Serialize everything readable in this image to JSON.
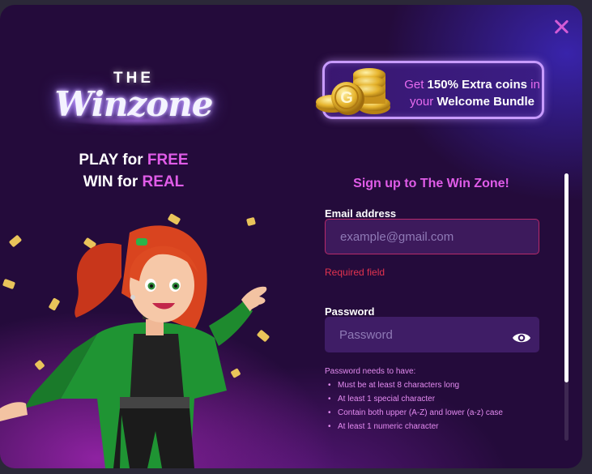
{
  "logo": {
    "the": "THE",
    "main": "Winzone"
  },
  "tagline": {
    "line1_a": "PLAY for ",
    "line1_b": "FREE",
    "line2_a": "WIN for ",
    "line2_b": "REAL"
  },
  "promo": {
    "get": "Get ",
    "percent": "150% Extra coins",
    "in": " in",
    "your": "your ",
    "bundle": "Welcome Bundle",
    "coin_letter": "G"
  },
  "form": {
    "title": "Sign up to The Win Zone!",
    "email_label": "Email address",
    "email_placeholder": "example@gmail.com",
    "email_error": "Required field",
    "password_label": "Password",
    "password_placeholder": "Password",
    "rules_heading": "Password needs to have:",
    "rules": [
      "Must be at least 8 characters long",
      "At least 1 special character",
      "Contain both upper (A-Z) and lower (a-z) case",
      "At least 1 numeric character"
    ]
  },
  "icons": {
    "close": "close-icon",
    "eye": "eye-icon",
    "coin": "coin-icon"
  },
  "colors": {
    "accent": "#e05ce8",
    "error": "#e2334f",
    "field_bg": "#3f1d66",
    "modal_bg": "#240b3b"
  }
}
